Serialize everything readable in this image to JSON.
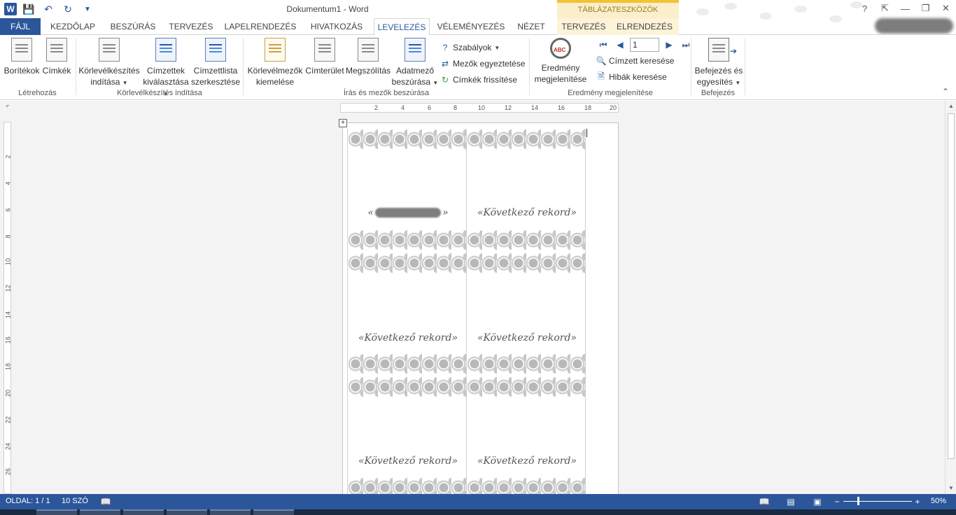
{
  "app": {
    "title": "Dokumentum1 - Word",
    "context_header": "TÁBLÁZATESZKÖZÖK",
    "window_controls": [
      "?",
      "⇱",
      "—",
      "❐",
      "✕"
    ]
  },
  "tabs": [
    {
      "label": "FÁJL"
    },
    {
      "label": "KEZDŐLAP"
    },
    {
      "label": "BESZÚRÁS"
    },
    {
      "label": "TERVEZÉS"
    },
    {
      "label": "LAPELRENDEZÉS"
    },
    {
      "label": "HIVATKOZÁS"
    },
    {
      "label": "LEVELEZÉS"
    },
    {
      "label": "VÉLEMÉNYEZÉS"
    },
    {
      "label": "NÉZET"
    },
    {
      "label": "TERVEZÉS"
    },
    {
      "label": "ELRENDEZÉS"
    }
  ],
  "ribbon": {
    "create": {
      "label": "Létrehozás",
      "envelopes": "Borítékok",
      "labels": "Címkék"
    },
    "start_merge": {
      "label": "Körlevélkészítés indítása",
      "start_mail_merge_l1": "Körlevélkészítés",
      "start_mail_merge_l2": "indítása",
      "select_recipients_l1": "Címzettek",
      "select_recipients_l2": "kiválasztása",
      "edit_list_l1": "Címzettlista",
      "edit_list_l2": "szerkesztése"
    },
    "write_insert": {
      "label": "Írás és mezők beszúrása",
      "highlight_l1": "Körlevélmezők",
      "highlight_l2": "kiemelése",
      "address_block": "Címterület",
      "greeting_line": "Megszólítás",
      "insert_field_l1": "Adatmező",
      "insert_field_l2": "beszúrása",
      "rules": "Szabályok",
      "match_fields": "Mezők egyeztetése",
      "update_labels": "Címkék frissítése"
    },
    "preview": {
      "label": "Eredmény megjelenítése",
      "preview_l1": "Eredmény",
      "preview_l2": "megjelenítése",
      "record_value": "1",
      "find_recipient": "Címzett keresése",
      "check_errors": "Hibák keresése"
    },
    "finish": {
      "label": "Befejezés",
      "finish_l1": "Befejezés és",
      "finish_l2": "egyesítés"
    }
  },
  "ruler": {
    "h_ticks": [
      "2",
      "4",
      "6",
      "8",
      "10",
      "12",
      "14",
      "16",
      "18",
      "20"
    ],
    "v_ticks": [
      "2",
      "4",
      "6",
      "8",
      "10",
      "12",
      "14",
      "16",
      "18",
      "20",
      "22",
      "24",
      "26"
    ]
  },
  "document": {
    "cells": [
      {
        "text_l": "«",
        "text_r": "»",
        "redacted": true
      },
      {
        "text": "«Következő rekord»"
      },
      {
        "text": "«Következő rekord»"
      },
      {
        "text": "«Következő rekord»"
      },
      {
        "text": "«Következő rekord»"
      },
      {
        "text": "«Következő rekord»"
      }
    ]
  },
  "status": {
    "page": "OLDAL: 1 / 1",
    "words": "10 SZÓ",
    "zoom": "50%"
  },
  "colors": {
    "accent": "#2b579a",
    "context": "#f1c232"
  }
}
